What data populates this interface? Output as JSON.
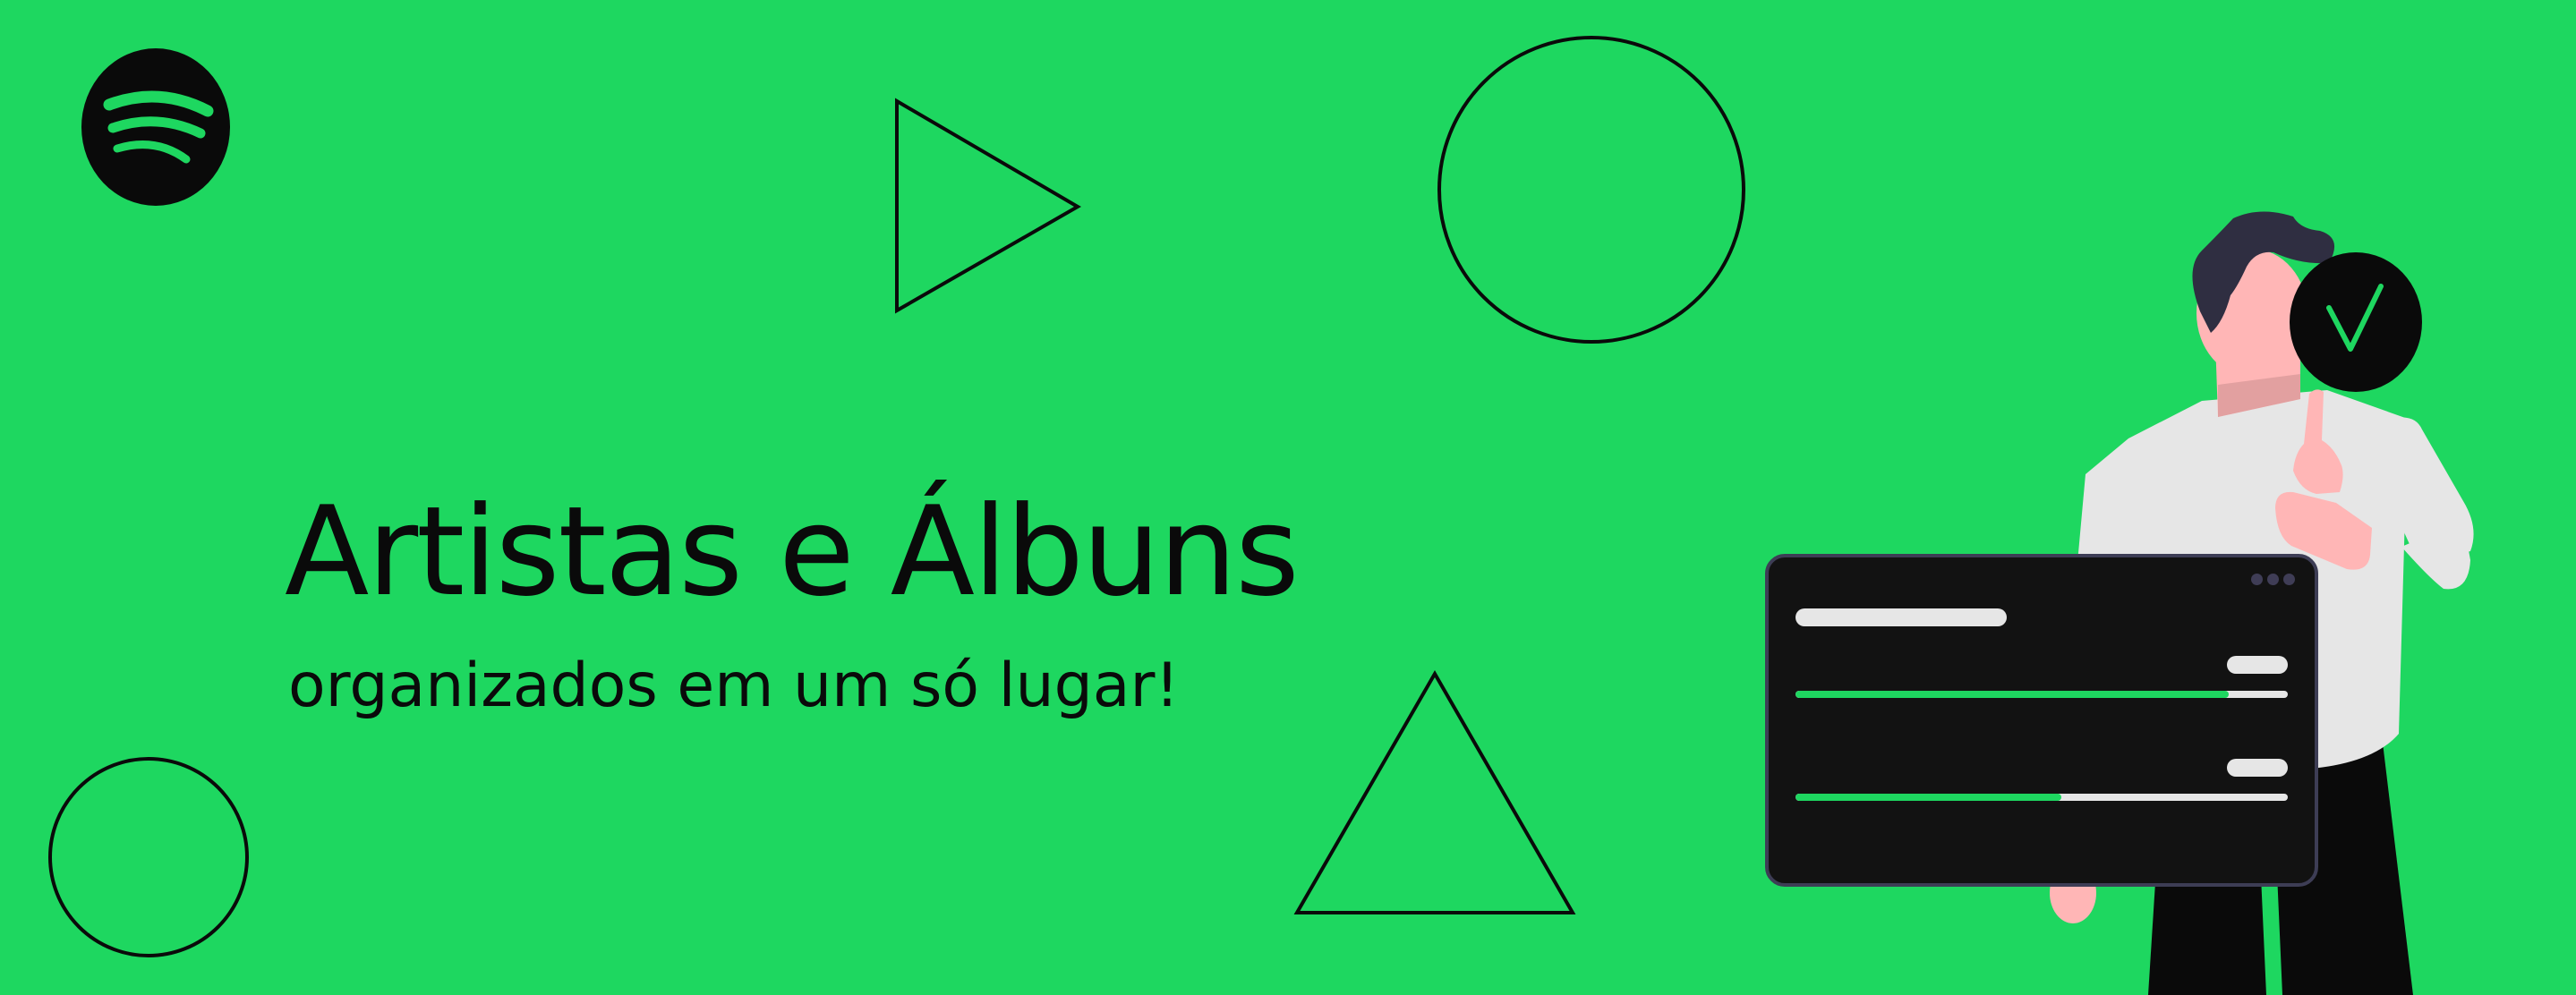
{
  "brand": {
    "logo_icon": "spotify-logo-icon",
    "background_color": "#1ed760",
    "ink_color": "#0a0a0a"
  },
  "hero": {
    "headline": "Artistas e Álbuns",
    "tagline": "organizados em um só lugar!"
  },
  "decorations": [
    "play-triangle-icon",
    "circle-outline",
    "triangle-outline",
    "circle-outline"
  ],
  "illustration": {
    "person": "person-illustration",
    "badge_icon": "checkmark-icon",
    "player_card": {
      "menu_icon": "more-dots-icon",
      "tracks": [
        {
          "progress": 0.88
        },
        {
          "progress": 0.54
        }
      ],
      "panel_color": "#121212",
      "accent": "#1ed760",
      "bar_color": "#e6e6e6"
    }
  }
}
